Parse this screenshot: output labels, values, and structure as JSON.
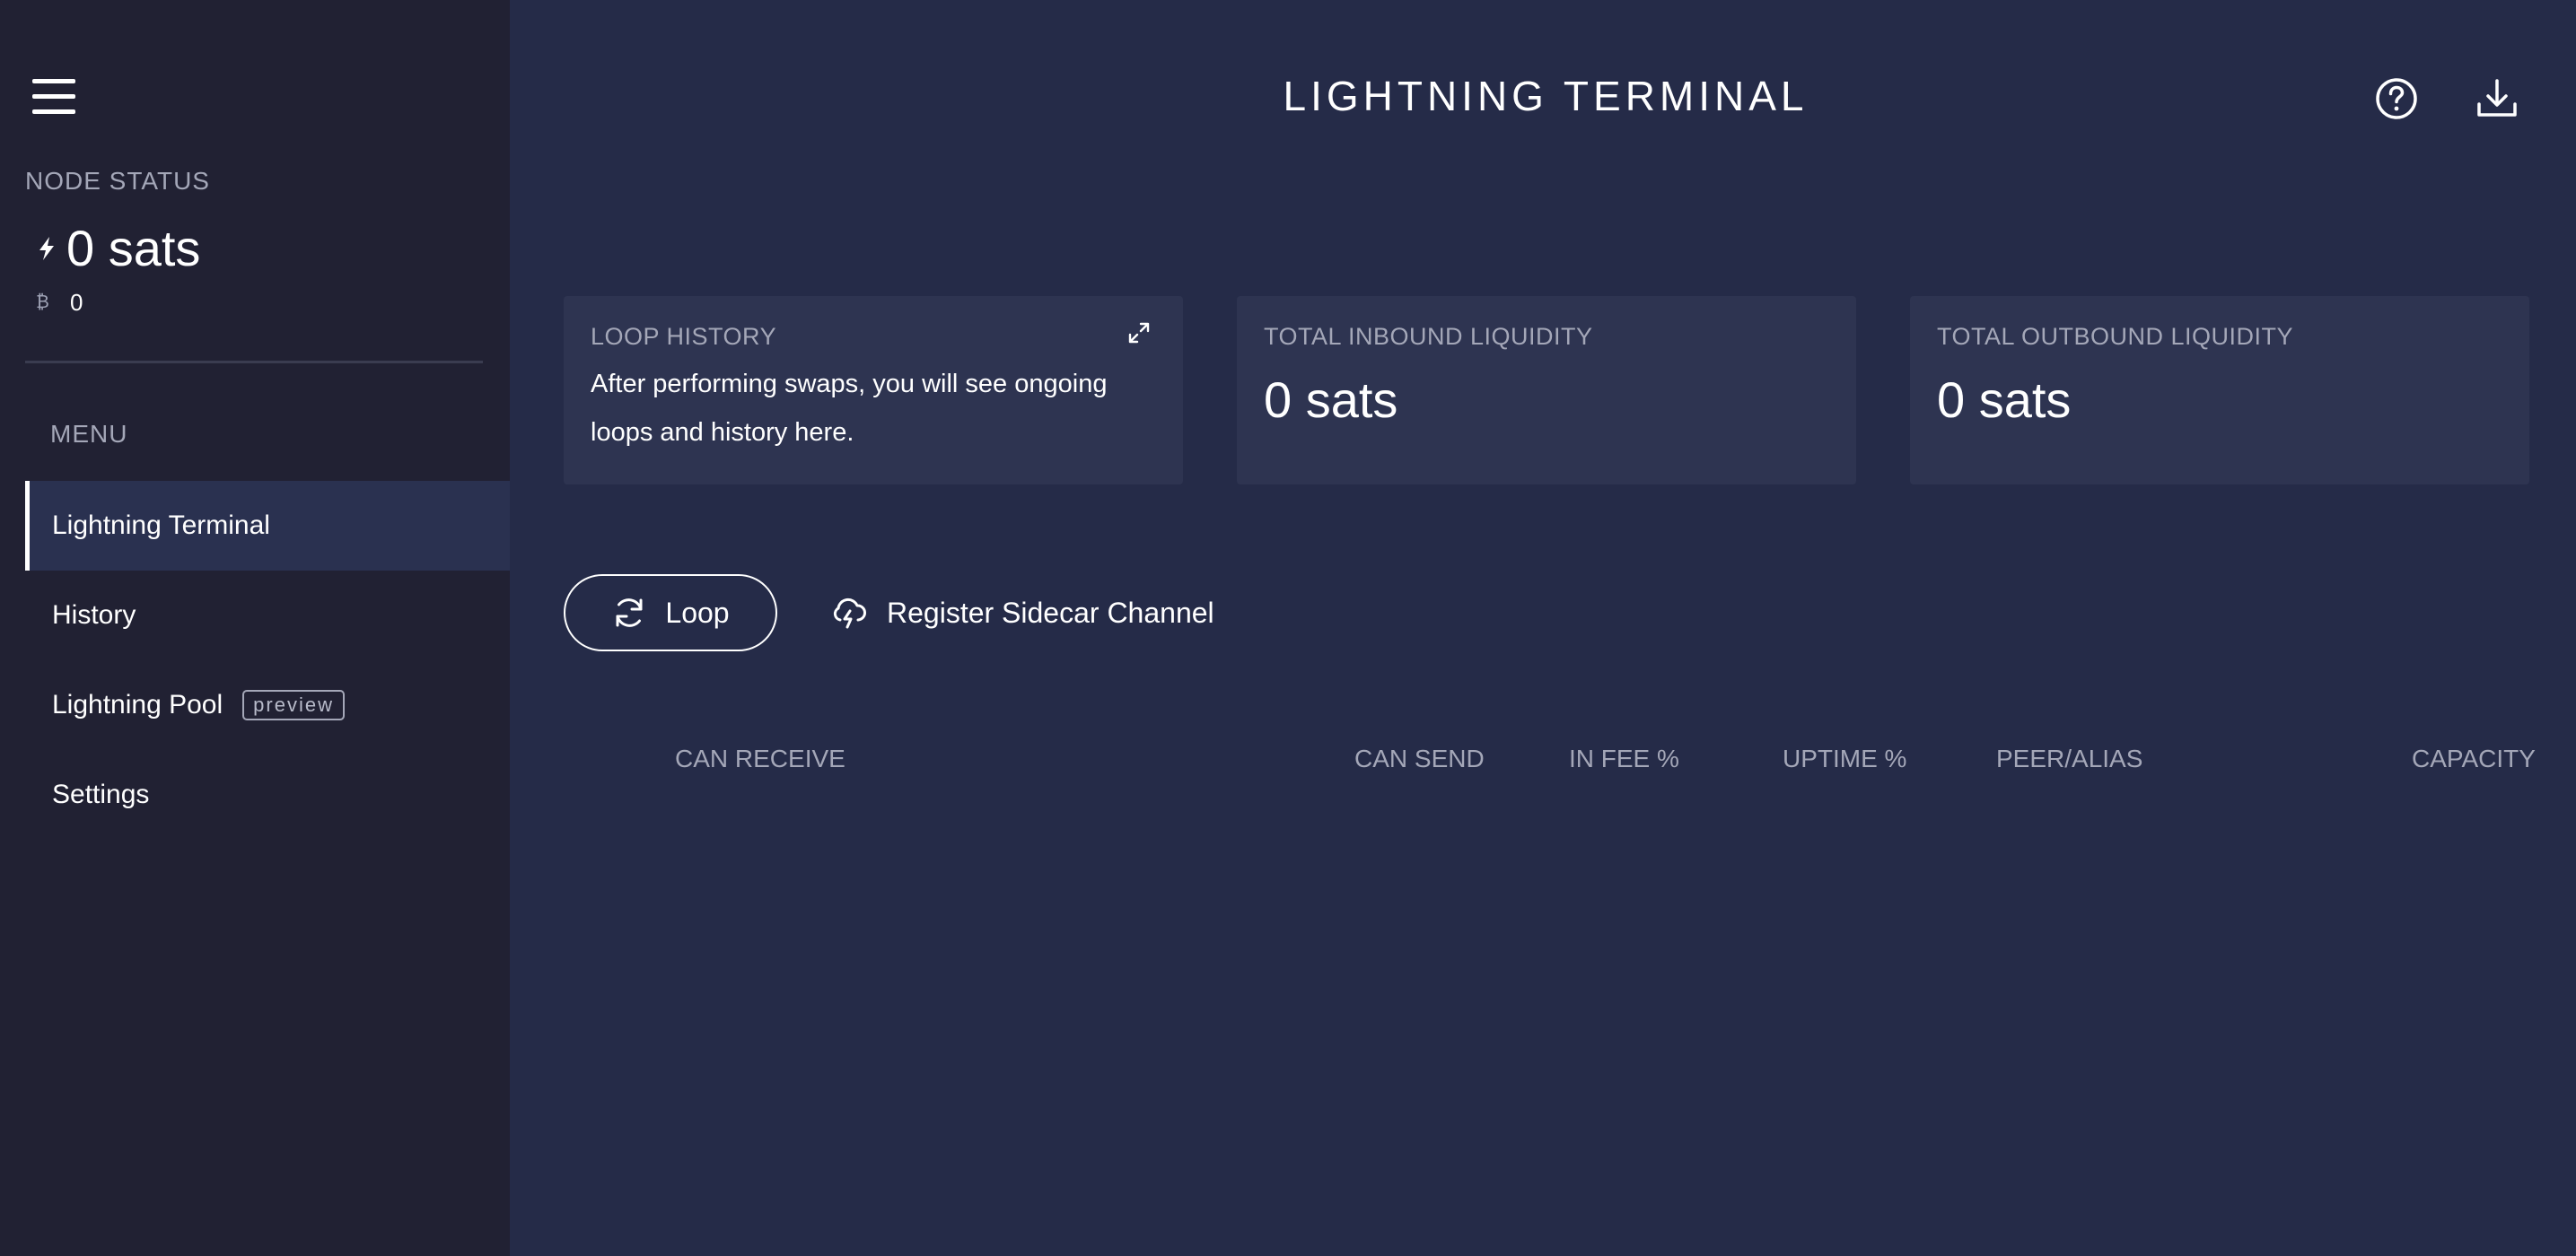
{
  "sidebar": {
    "menu_icon": "hamburger-menu-icon",
    "node_status_label": "NODE STATUS",
    "lightning_balance": "0 sats",
    "lightning_icon": "lightning-bolt-icon",
    "bitcoin_balance": "0",
    "bitcoin_icon": "bitcoin-icon",
    "menu_label": "MENU",
    "items": [
      {
        "label": "Lightning Terminal",
        "active": true
      },
      {
        "label": "History"
      },
      {
        "label": "Lightning Pool",
        "badge": "preview"
      },
      {
        "label": "Settings"
      }
    ]
  },
  "header": {
    "title": "LIGHTNING TERMINAL",
    "help_icon": "help-circle-icon",
    "download_icon": "download-icon"
  },
  "tiles": {
    "loop_history": {
      "title": "LOOP HISTORY",
      "text_line1": "After performing swaps, you will see ongoing",
      "text_line2": "loops and history here.",
      "expand_icon": "expand-arrows-icon"
    },
    "inbound": {
      "title": "TOTAL INBOUND LIQUIDITY",
      "value": "0 sats"
    },
    "outbound": {
      "title": "TOTAL OUTBOUND LIQUIDITY",
      "value": "0 sats"
    }
  },
  "actions": {
    "loop_label": "Loop",
    "loop_icon": "refresh-icon",
    "sidecar_label": "Register Sidecar Channel",
    "sidecar_icon": "cloud-lightning-icon"
  },
  "table": {
    "columns": [
      "CAN RECEIVE",
      "CAN SEND",
      "IN FEE %",
      "UPTIME %",
      "PEER/ALIAS",
      "CAPACITY"
    ]
  },
  "colors": {
    "background": "#252b48",
    "sidebar": "#212133",
    "tile": "#2e3451",
    "active_item": "#2a3150",
    "muted_text": "#a4a7b8"
  }
}
